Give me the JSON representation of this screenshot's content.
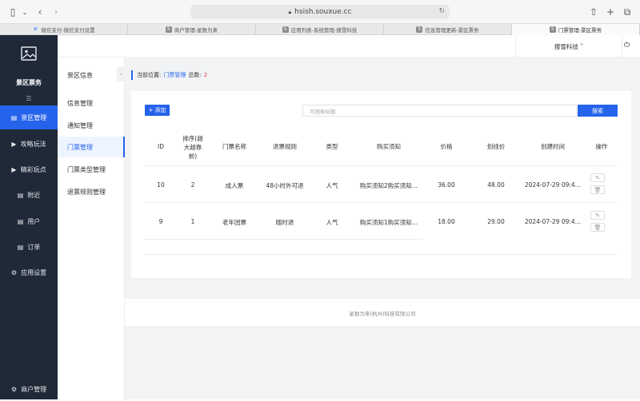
{
  "browser": {
    "url": "hsish.souxue.cc",
    "tabs": [
      {
        "label": "微信支付-微信支付设置",
        "fav": "",
        "icon": "wechat-pay-icon"
      },
      {
        "label": "商户管理-星数为来",
        "fav": "S",
        "icon": "s-icon"
      },
      {
        "label": "应用列表-系统管理-搜雪科技",
        "fav": "S",
        "icon": "s-icon"
      },
      {
        "label": "信息管理更新-景区票务",
        "fav": "S",
        "icon": "s-icon"
      },
      {
        "label": "门票管理-景区票务",
        "fav": "S",
        "icon": "s-icon"
      }
    ]
  },
  "sidebar": {
    "brand": "景区票务",
    "items": [
      {
        "label": "景区管理",
        "icon": "document-icon",
        "glyph": "▤"
      },
      {
        "label": "攻略玩法",
        "icon": "video-icon",
        "glyph": "▶"
      },
      {
        "label": "精彩玩点",
        "icon": "video-icon",
        "glyph": "▶"
      },
      {
        "label": "附近",
        "icon": "document-icon",
        "glyph": "▤"
      },
      {
        "label": "用户",
        "icon": "document-icon",
        "glyph": "▤"
      },
      {
        "label": "订单",
        "icon": "document-icon",
        "glyph": "▤"
      },
      {
        "label": "应用设置",
        "icon": "gear-icon",
        "glyph": "⚙"
      }
    ],
    "bottom": {
      "label": "商户管理",
      "icon": "gear-icon",
      "glyph": "⚙"
    }
  },
  "subnav": {
    "title": "景区信息",
    "items": [
      "信息管理",
      "通知管理",
      "门票管理",
      "门票类型管理",
      "退票规则管理"
    ]
  },
  "header": {
    "company": "搜雪科技 ˅"
  },
  "breadcrumb": {
    "prefix": "当前位置:",
    "current": "门票管理",
    "total_label": "总数:",
    "total": "2"
  },
  "toolbar": {
    "add_label": "+ 添加",
    "search_placeholder": "可搜索标题",
    "search_label": "搜索"
  },
  "table": {
    "headers": [
      "ID",
      "排序(越\n大越靠\n前)",
      "门票名称",
      "退票规则",
      "类型",
      "购买须知",
      "价格",
      "划线价",
      "创建时间",
      "操作"
    ],
    "rows": [
      {
        "id": "10",
        "sort": "2",
        "name": "成人票",
        "rule": "48小时外可退",
        "type": "人气",
        "notice": "购买须知2购买须知…",
        "price": "36.00",
        "strike": "48.00",
        "created": "2024-07-29 09:4…"
      },
      {
        "id": "9",
        "sort": "1",
        "name": "老年团票",
        "rule": "随时退",
        "type": "人气",
        "notice": "购买须知1购买须知…",
        "price": "18.00",
        "strike": "29.00",
        "created": "2024-07-29 09:4…"
      }
    ]
  },
  "footer": {
    "text": "星数为来(杭州)科技有限公司"
  }
}
